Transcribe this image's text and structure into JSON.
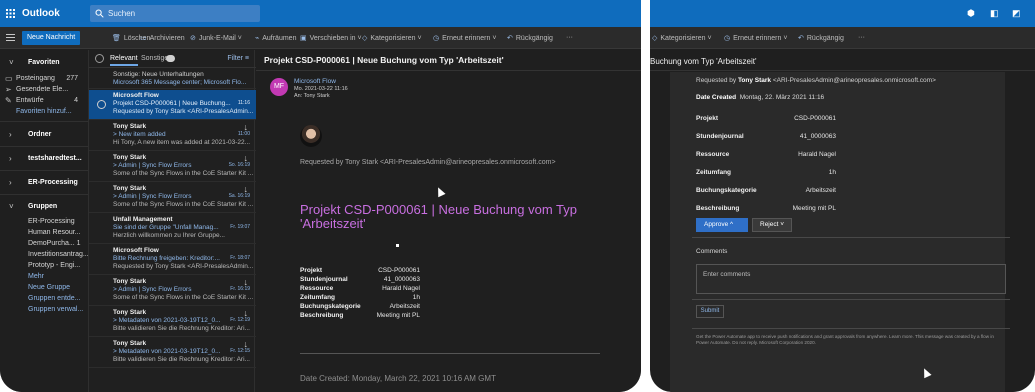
{
  "app": {
    "name": "Outlook",
    "search_placeholder": "Suchen"
  },
  "toolbar": {
    "new_message": "Neue Nachricht",
    "delete": "Löschen",
    "archive": "Archivieren",
    "junk": "Junk-E-Mail",
    "cleanup": "Aufräumen",
    "move": "Verschieben in",
    "categorize": "Kategorisieren",
    "snooze": "Erneut erinnern",
    "undo": "Rückgängig",
    "more": "···"
  },
  "folders": {
    "favorites": "Favoriten",
    "inbox": "Posteingang",
    "inbox_count": "277",
    "sent": "Gesendete Ele...",
    "drafts": "Entwürfe",
    "drafts_count": "4",
    "add_favorite": "Favoriten hinzuf...",
    "ordner": "Ordner",
    "testshared": "testsharedtest...",
    "er_processing": "ER-Processing",
    "groups": "Gruppen",
    "group_items": [
      "ER-Processing",
      "Human Resour...",
      "DemoPurcha... 1",
      "Investitionsantrag...",
      "Prototyp - Engi...",
      "Mehr",
      "Neue Gruppe",
      "Gruppen entde...",
      "Gruppen verwal..."
    ]
  },
  "list": {
    "focused": "Relevant",
    "other": "Sonstige",
    "filter": "Filter",
    "messages": [
      {
        "from": "Sonstige: Neue Unterhaltungen",
        "subject": "Microsoft 365 Message center; Microsoft Flo...",
        "preview": "",
        "time": "",
        "arrow": ""
      },
      {
        "from": "Microsoft Flow",
        "subject": "Projekt CSD-P000061 | Neue Buchung...",
        "preview": "Requested by Tony Stark <ARI-PresalesAdmin...",
        "time": "11:16",
        "arrow": ""
      },
      {
        "from": "Tony Stark",
        "subject": "> New item added",
        "preview": "Hi Tony, A new item was added at 2021-03-22...",
        "time": "11:00",
        "arrow": "↓"
      },
      {
        "from": "Tony Stark",
        "subject": "> Admin | Sync Flow Errors",
        "preview": "Some of the Sync Flows in the CoE Starter Kit ...",
        "time": "So. 16:19",
        "arrow": "↓"
      },
      {
        "from": "Tony Stark",
        "subject": "> Admin | Sync Flow Errors",
        "preview": "Some of the Sync Flows in the CoE Starter Kit ...",
        "time": "Sa. 16:19",
        "arrow": "↓"
      },
      {
        "from": "Unfall Management",
        "subject": "Sie sind der Gruppe \"Unfall Manag...",
        "preview": "Herzlich willkommen zu Ihrer Gruppe...",
        "time": "Fr. 19:07",
        "arrow": ""
      },
      {
        "from": "Microsoft Flow",
        "subject": "Bitte Rechnung freigeben: Kreditor:...",
        "preview": "Requested by Tony Stark <ARI-PresalesAdmin...",
        "time": "Fr. 18:07",
        "arrow": ""
      },
      {
        "from": "Tony Stark",
        "subject": "> Admin | Sync Flow Errors",
        "preview": "Some of the Sync Flows in the CoE Starter Kit ...",
        "time": "Fr. 16:19",
        "arrow": "↓"
      },
      {
        "from": "Tony Stark",
        "subject": "> Metadaten von 2021-03-19T12_0...",
        "preview": "Bitte validieren Sie die Rechnung Kreditor: Ari...",
        "time": "Fr. 12:19",
        "arrow": "↓"
      },
      {
        "from": "Tony Stark",
        "subject": "> Metadaten von 2021-03-19T12_0...",
        "preview": "Bitte validieren Sie die Rechnung Kreditor: Ari...",
        "time": "Fr. 12:15",
        "arrow": "↓"
      }
    ]
  },
  "reading": {
    "title": "Projekt CSD-P000061 | Neue Buchung vom Typ 'Arbeitszeit'",
    "avatar_initials": "MF",
    "sender": "Microsoft Flow",
    "date": "Mo. 2021-03-22 11:16",
    "to": "An: Tony Stark",
    "requested_by": "Requested by Tony Stark <ARI-PresalesAdmin@arineopresales.onmicrosoft.com>",
    "big_title": "Projekt CSD-P000061 | Neue Buchung vom Typ 'Arbeitszeit'",
    "details": [
      {
        "k": "Projekt",
        "v": "CSD-P000061"
      },
      {
        "k": "Stundenjournal",
        "v": "41_0000063"
      },
      {
        "k": "Ressource",
        "v": "Harald Nagel"
      },
      {
        "k": "Zeitumfang",
        "v": "1h"
      },
      {
        "k": "Buchungskategorie",
        "v": "Arbeitszeit"
      },
      {
        "k": "Beschreibung",
        "v": "Meeting mit PL"
      }
    ],
    "date_created": "Date Created: Monday, March 22, 2021 10:16 AM GMT"
  },
  "right": {
    "toolbar": {
      "categorize": "Kategorisieren",
      "snooze": "Erneut erinnern",
      "undo": "Rückgängig",
      "more": "···"
    },
    "title": "Buchung vom Typ 'Arbeitszeit'",
    "requested_prefix": "Requested by",
    "requested_name": "Tony Stark",
    "requested_email": "<ARI-PresalesAdmin@arineopresales.onmicrosoft.com>",
    "date_label": "Date Created",
    "date_value": "Montag, 22. März 2021 11:16",
    "details": [
      {
        "k": "Projekt",
        "v": "CSD-P000061"
      },
      {
        "k": "Stundenjournal",
        "v": "41_0000063"
      },
      {
        "k": "Ressource",
        "v": "Harald Nagel"
      },
      {
        "k": "Zeitumfang",
        "v": "1h"
      },
      {
        "k": "Buchungskategorie",
        "v": "Arbeitszeit"
      },
      {
        "k": "Beschreibung",
        "v": "Meeting mit PL"
      }
    ],
    "approve": "Approve ^",
    "reject": "Reject ˅",
    "comments_label": "Comments",
    "comments_placeholder": "Enter comments",
    "submit": "Submit",
    "footer": "Get the Power Automate app to receive push notifications and grant approvals from anywhere. Learn more. This message was created by a flow in Power Automate. Do not reply. Microsoft Corporation 2020."
  },
  "colors": {
    "accent": "#0f6cbd",
    "selected_row": "#0e4e8f",
    "title_purple": "#c86fe0",
    "link_blue": "#8fb8ea",
    "avatar": "#c239b3"
  }
}
